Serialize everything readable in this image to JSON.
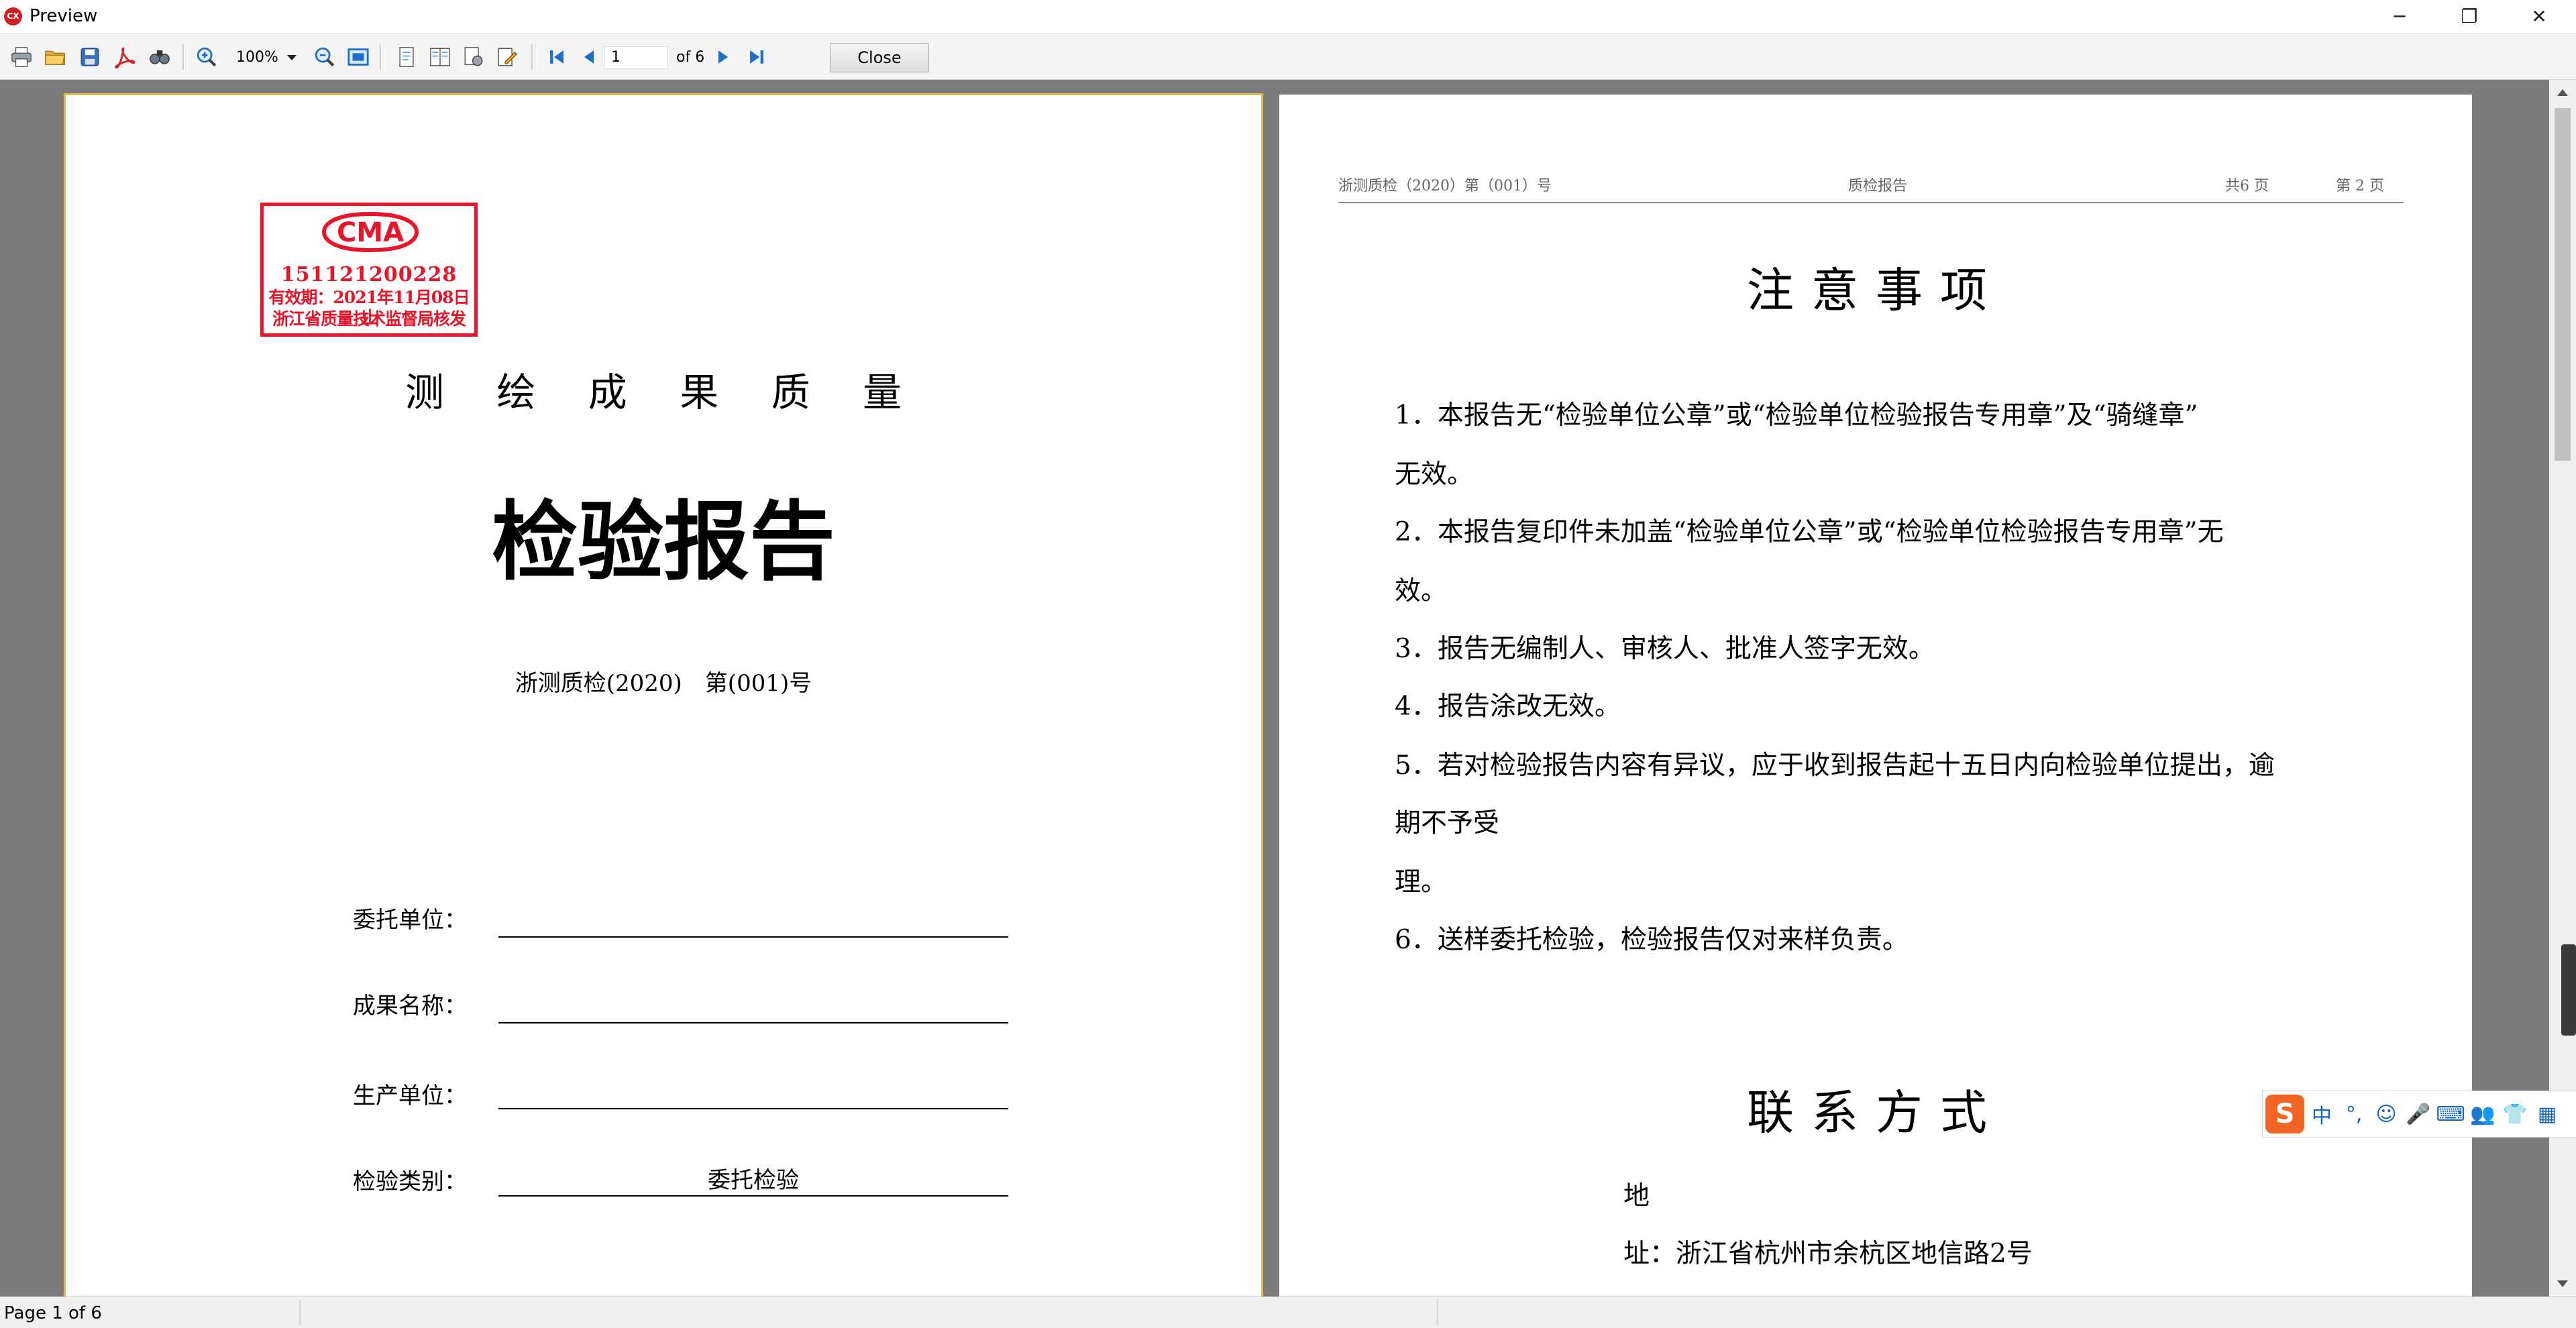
{
  "window": {
    "app_icon_label": "CX",
    "title": "Preview",
    "minimize_glyph": "─",
    "maximize_glyph": "❐",
    "close_glyph": "✕"
  },
  "toolbar": {
    "icons": [
      "print-icon",
      "open-folder-icon",
      "save-icon",
      "pdf-export-icon",
      "find-icon",
      "zoom-in-icon",
      "zoom-out-icon",
      "fit-page-icon",
      "single-page-icon",
      "two-page-icon",
      "page-setup-icon",
      "edit-icon",
      "first-page-icon",
      "previous-page-icon",
      "next-page-icon",
      "last-page-icon"
    ],
    "zoom_value": "100%",
    "page_input_value": "1",
    "page_of_label": "of 6",
    "close_label": "Close"
  },
  "left_page": {
    "stamp": {
      "logo_text": "CMA",
      "number": "151121200228",
      "validity": "有效期：2021年11月08日止",
      "issuer": "浙江省质量技术监督局核发"
    },
    "subtitle": "测 绘 成 果 质 量",
    "title": "检验报告",
    "report_number": "浙测质检(2020)　第(001)号",
    "fields": [
      {
        "label": "委托单位：",
        "value": ""
      },
      {
        "label": "成果名称：",
        "value": ""
      },
      {
        "label": "生产单位：",
        "value": ""
      },
      {
        "label": "检验类别：",
        "value": "委托检验"
      }
    ]
  },
  "right_page": {
    "header": {
      "report_no": "浙测质检（2020）第（001）号",
      "doc_type": "质检报告",
      "total_pages": "共6 页",
      "page_no": "第 2 页"
    },
    "notice_title": "注意事项",
    "notice_lines": [
      "1．本报告无“检验单位公章”或“检验单位检验报告专用章”及“骑缝章”",
      "无效。",
      "2．本报告复印件未加盖“检验单位公章”或“检验单位检验报告专用章”无",
      "效。",
      "3．报告无编制人、审核人、批准人签字无效。",
      "4．报告涂改无效。",
      "5．若对检验报告内容有异议，应于收到报告起十五日内向检验单位提出，逾",
      "期不予受",
      "理。",
      "6．送样委托检验，检验报告仅对来样负责。"
    ],
    "contact_title": "联系方式",
    "address_lines": [
      "地",
      "址：浙江省杭州市余杭区地信路2号"
    ]
  },
  "ime": {
    "logo": "S",
    "mode": "中",
    "items": [
      "°,",
      "☺",
      "🎤",
      "⌨",
      "👥",
      "👕",
      "▦"
    ]
  },
  "status": {
    "page_status": "Page 1 of 6"
  },
  "colors": {
    "stamp_red": "#e8142a",
    "viewer_background": "#7b7b7b",
    "selected_page_border": "#e4b94a",
    "icon_blue": "#1e6fc8"
  }
}
